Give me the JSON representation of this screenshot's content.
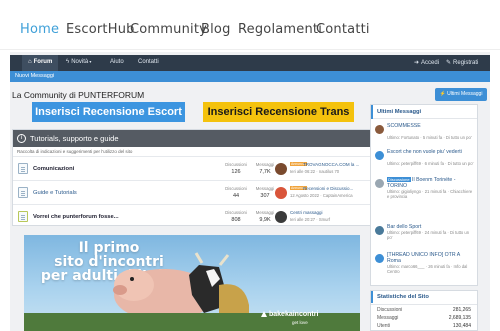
{
  "site_nav": {
    "items": [
      "Home",
      "EscortHub",
      "Community",
      "Blog",
      "Regolamenti",
      "Contatti"
    ]
  },
  "forum_nav": {
    "forum": "Forum",
    "novita": "Novità",
    "aiuto": "Aiuto",
    "contatti": "Contatti",
    "accedi": "Accedi",
    "registrati": "Registrati"
  },
  "sub_nav": {
    "nuovi_messaggi": "Nuovi Messaggi"
  },
  "page_title": "La Community di PUNTERFORUM",
  "buttons": {
    "recensione_escort": "Inserisci Recensione Escort",
    "recensione_trans": "Inserisci Recensione Trans",
    "ultimi_messaggi": "Ultimi Messaggi"
  },
  "category": {
    "title": "Tutorials, supporto e guide",
    "description": "Raccolta di indicazioni e suggerimenti per l'utilizzo del sito",
    "discussioni_label": "Discussioni",
    "messaggi_label": "Messaggi",
    "forums": [
      {
        "name": "Comunicazioni",
        "discussioni": "126",
        "messaggi": "7,7K",
        "badge": "Annuncio",
        "last_title": "TROVAGNOCCA.COM la ...",
        "last_meta": "Ieri alle 06:22 · nautilus 70"
      },
      {
        "name": "Guide e Tutorials",
        "discussioni": "44",
        "messaggi": "307",
        "badge": "Annuncio",
        "last_title": "Recensioni e Discussio...",
        "last_meta": "12 Agosto 2022 · CaptainAmerica"
      },
      {
        "name": "Vorrei che punterforum fosse...",
        "discussioni": "808",
        "messaggi": "9,9K",
        "badge": "",
        "last_title": "Centri massaggi",
        "last_meta": "Ieri alle 20:27 · Smurf"
      }
    ]
  },
  "banner": {
    "line1": "Il primo",
    "line2": "sito d'incontri",
    "line3": "per adulti d'italia",
    "brand": "bakekaincontri",
    "tagline": "get love"
  },
  "sidebar": {
    "title": "Ultimi Messaggi",
    "items": [
      {
        "title": "SCOMMESSE",
        "meta": "Ultimo: Fortunato · 5 minuti fa · Di tutto un po'",
        "tag": ""
      },
      {
        "title": "Escort che non vuole piu' vederti",
        "meta": "Ultimo: peterpiff69 · 6 minuti fa · Di tutto un po'",
        "tag": ""
      },
      {
        "title": "Il Boenm Torinéte - TORINO",
        "meta": "Ultimo: gigioliyngo · 21 minuti fa · Chiacchiere e provincia",
        "tag": "Discussione"
      },
      {
        "title": "Bar dello Sport",
        "meta": "Ultimo: peterpiff69 · 24 minuti fa · Di tutto un po'",
        "tag": ""
      },
      {
        "title": "[THREAD UNICO INFO] OTR A Roma",
        "meta": "Ultimo: marco66___ · 26 minuti fa · Info dal Centro",
        "tag": ""
      }
    ]
  },
  "stats": {
    "title": "Statistiche del Sito",
    "rows": [
      {
        "label": "Discussioni",
        "value": "281,265"
      },
      {
        "label": "Messaggi",
        "value": "2,689,135"
      },
      {
        "label": "Utenti",
        "value": "130,484"
      }
    ]
  },
  "colors": {
    "accent": "#3d8fd6",
    "nav_dark": "#2e3b4a",
    "escort_button": "#3c95e0",
    "trans_button": "#f4c20d",
    "annuncio_badge": "#f0a33a"
  }
}
